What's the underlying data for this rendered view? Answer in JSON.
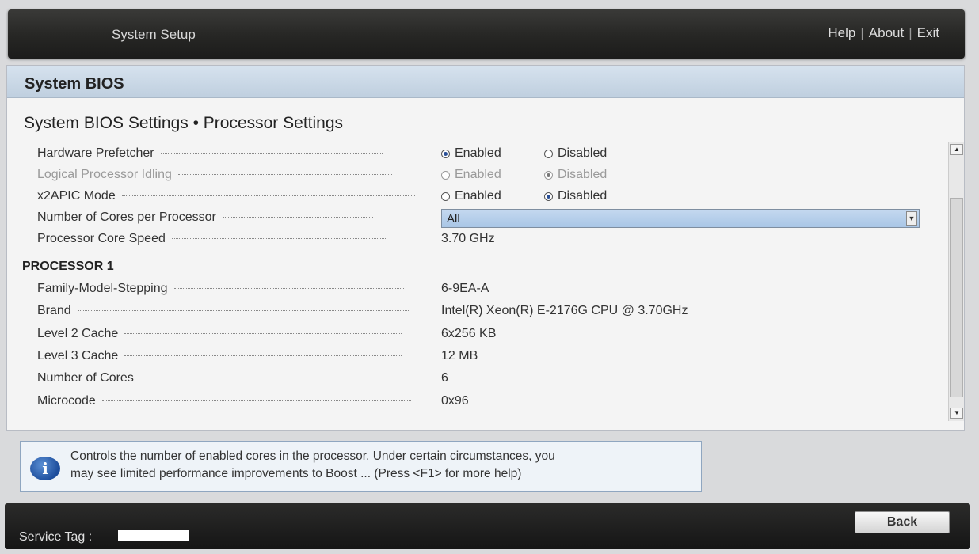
{
  "topbar": {
    "title": "System Setup",
    "links": [
      "Help",
      "About",
      "Exit"
    ],
    "separator": "|"
  },
  "panel": {
    "title": "System BIOS",
    "breadcrumb": "System BIOS Settings • Processor Settings"
  },
  "settings": [
    {
      "label": "Hardware Prefetcher",
      "type": "radio",
      "options": [
        "Enabled",
        "Disabled"
      ],
      "selected": "Enabled",
      "disabled": false
    },
    {
      "label": "Logical Processor Idling",
      "type": "radio",
      "options": [
        "Enabled",
        "Disabled"
      ],
      "selected": "Disabled",
      "disabled": true
    },
    {
      "label": "x2APIC Mode",
      "type": "radio",
      "options": [
        "Enabled",
        "Disabled"
      ],
      "selected": "Disabled",
      "disabled": false
    },
    {
      "label": "Number of Cores per Processor",
      "type": "select",
      "value": "All",
      "disabled": false
    },
    {
      "label": "Processor Core Speed",
      "type": "text",
      "value": "3.70 GHz",
      "disabled": false
    }
  ],
  "processor_section": {
    "heading": "PROCESSOR 1",
    "rows": [
      {
        "label": "Family-Model-Stepping",
        "value": "6-9EA-A"
      },
      {
        "label": "Brand",
        "value": "Intel(R) Xeon(R) E-2176G CPU @ 3.70GHz"
      },
      {
        "label": "Level 2 Cache",
        "value": "6x256 KB"
      },
      {
        "label": "Level 3 Cache",
        "value": "12 MB"
      },
      {
        "label": "Number of Cores",
        "value": "6"
      },
      {
        "label": "Microcode",
        "value": "0x96"
      }
    ]
  },
  "info": {
    "icon": "info-icon",
    "line1": "Controls the number of enabled cores in the processor. Under certain circumstances, you",
    "line2": "may see limited performance improvements to Boost ... (Press <F1> for more help)"
  },
  "footer": {
    "service_tag_label": "Service Tag :",
    "back_label": "Back"
  },
  "colors": {
    "header_gradient_top": "#d6e2ee",
    "select_highlight": "#a9c6e6",
    "radio_selected": "#2a4f96"
  }
}
